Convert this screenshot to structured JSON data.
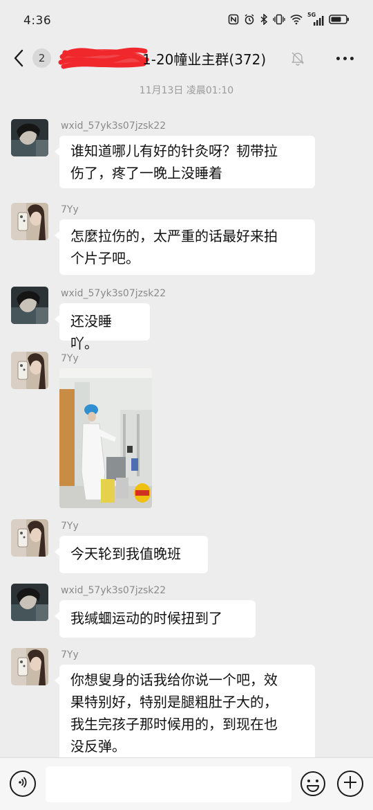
{
  "status_bar": {
    "time": "4:36",
    "network_label": "5G"
  },
  "nav": {
    "unread_count": "2",
    "title": "1-20幢业主群(372)"
  },
  "timestamp": "11月13日 凌晨01:10",
  "messages": [
    {
      "sender": "wxid_57yk3s07jzsk22",
      "text": [
        "谁知道哪儿有好的针灸呀？韧带拉",
        "伤了，疼了一晚上没睡着"
      ]
    },
    {
      "sender": "7Yy",
      "text": [
        "怎麼拉伤的，太严重的话最好来拍",
        "个片子吧。"
      ]
    },
    {
      "sender": "wxid_57yk3s07jzsk22",
      "text": [
        "还没睡吖。"
      ]
    },
    {
      "sender": "7Yy",
      "text": []
    },
    {
      "sender": "7Yy",
      "text": [
        "今天轮到我值晚班"
      ]
    },
    {
      "sender": "wxid_57yk3s07jzsk22",
      "text": [
        "我缄蜖运动的时候扭到了"
      ]
    },
    {
      "sender": "7Yy",
      "text": [
        "你想叟身的话我给你说一个吧，效",
        "果特别好，特别是腿粗肚子大的，",
        "我生完孩子那时候用的，到现在也",
        "没反弹。"
      ]
    }
  ],
  "colors": {
    "background": "#ededed",
    "bubble": "#ffffff",
    "redaction": "#f0282d"
  }
}
